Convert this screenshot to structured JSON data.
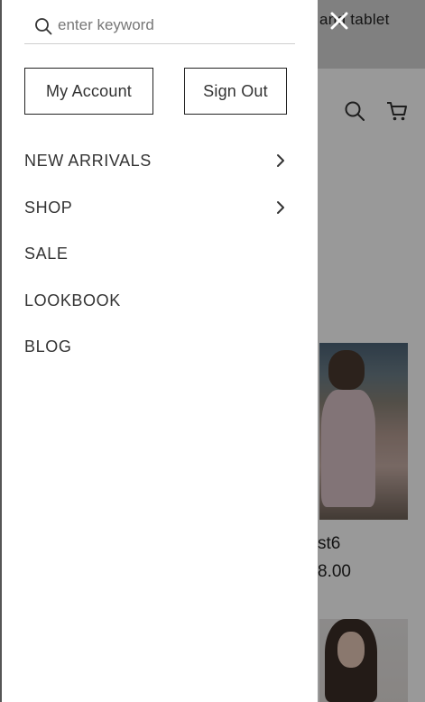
{
  "page": {
    "banner_text": "and tablet",
    "product": {
      "name": "st6",
      "price": "8.00"
    }
  },
  "drawer": {
    "search": {
      "placeholder": "enter keyword",
      "value": ""
    },
    "buttons": {
      "account": "My Account",
      "sign_out": "Sign Out"
    },
    "menu": [
      {
        "label": "NEW ARRIVALS",
        "has_submenu": true
      },
      {
        "label": "SHOP",
        "has_submenu": true
      },
      {
        "label": "SALE",
        "has_submenu": false
      },
      {
        "label": "LOOKBOOK",
        "has_submenu": false
      },
      {
        "label": "BLOG",
        "has_submenu": false
      }
    ]
  },
  "icons": {
    "close": "close-icon",
    "search": "search-icon",
    "header_search": "search-icon",
    "cart": "cart-icon",
    "chevron": "chevron-right-icon"
  },
  "colors": {
    "overlay": "#000000",
    "drawer_bg": "#ffffff",
    "text": "#333333",
    "border": "#222222"
  }
}
